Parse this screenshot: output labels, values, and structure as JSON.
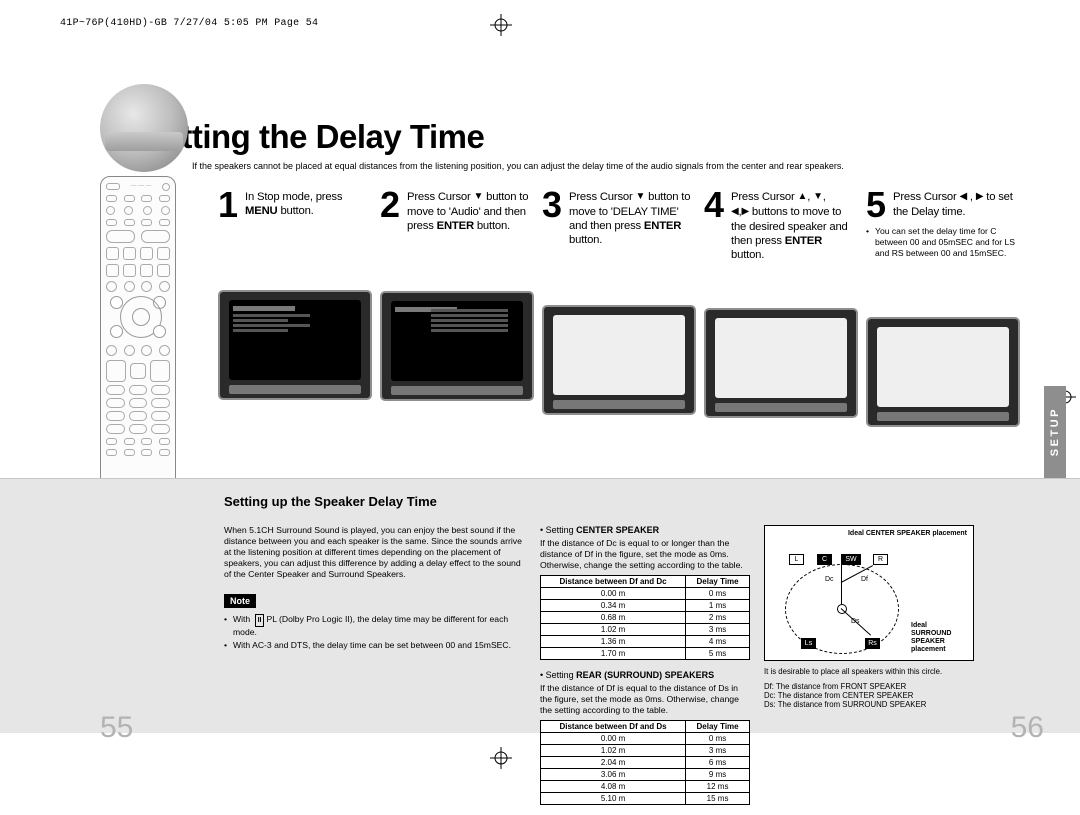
{
  "proofline": "41P~76P(410HD)-GB  7/27/04 5:05 PM  Page 54",
  "title": "Setting the Delay Time",
  "intro": "If the speakers cannot be placed at equal distances from the listening position, you can adjust the delay time of the audio signals from the center and rear speakers.",
  "tab": "SETUP",
  "steps": {
    "s1": {
      "num": "1",
      "pre": "In Stop mode, press ",
      "bold": "MENU",
      "post": " button."
    },
    "s2": {
      "num": "2",
      "pre": "Press Cursor ",
      "sym": "▼",
      "mid": " button to move to 'Audio' and then press ",
      "bold": "ENTER",
      "post": " button."
    },
    "s3": {
      "num": "3",
      "pre": "Press Cursor ",
      "sym": "▼",
      "mid": " button to move to 'DELAY TIME' and then press ",
      "bold": "ENTER",
      "post": " button."
    },
    "s4": {
      "num": "4",
      "l1a": "Press Cursor ",
      "l1b": "▲",
      "l1c": ", ",
      "l1d": "▼",
      "l1e": ",",
      "l2a": "◀",
      "l2b": ",",
      "l2c": "▶",
      "l2d": " buttons to move to the desired speaker and then press ",
      "bold": "ENTER",
      "post": " button."
    },
    "s5": {
      "num": "5",
      "pre": "Press Cursor ",
      "s1": "◀",
      "c": " , ",
      "s2": "▶",
      "post": " to set the Delay time."
    }
  },
  "note5": "You can set the delay time for C between 00 and 05mSEC and for LS and RS between 00 and 15mSEC.",
  "lower": {
    "heading": "Setting up the Speaker Delay Time",
    "para": "When 5.1CH Surround Sound is played, you can enjoy the best sound if the distance between you and each speaker is the same. Since the sounds arrive at the listening position at different times depending on the placement of speakers, you can adjust this difference by adding a delay effect to the sound of the Center Speaker and Surround Speakers.",
    "noteLabel": "Note",
    "note1": "With       PL  (Dolby Pro Logic II), the delay time may be different for each mode.",
    "pl2": "II",
    "note2": "With AC-3 and DTS, the delay time can be set between 00 and 15mSEC.",
    "center": {
      "h1": "• Setting ",
      "h2": "CENTER SPEAKER",
      "body": "If the distance of Dc is equal to or longer than the distance of Df in the figure, set the mode as 0ms. Otherwise, change the setting according to the table."
    },
    "rear": {
      "h1": "• Setting ",
      "h2": "REAR (SURROUND) SPEAKERS",
      "body": "If the distance of Df is equal to the distance of Ds in the figure, set the mode as 0ms. Otherwise, change the setting according to the table."
    },
    "t1": {
      "hd1": "Distance between Df and Dc",
      "hd2": "Delay Time",
      "r": [
        [
          "0.00 m",
          "0 ms"
        ],
        [
          "0.34 m",
          "1 ms"
        ],
        [
          "0.68 m",
          "2 ms"
        ],
        [
          "1.02 m",
          "3 ms"
        ],
        [
          "1.36 m",
          "4 ms"
        ],
        [
          "1.70 m",
          "5 ms"
        ]
      ]
    },
    "t2": {
      "hd1": "Distance between Df and Ds",
      "hd2": "Delay Time",
      "r": [
        [
          "0.00 m",
          "0 ms"
        ],
        [
          "1.02 m",
          "3 ms"
        ],
        [
          "2.04 m",
          "6 ms"
        ],
        [
          "3.06 m",
          "9 ms"
        ],
        [
          "4.08 m",
          "12 ms"
        ],
        [
          "5.10 m",
          "15 ms"
        ]
      ]
    },
    "diag": {
      "ideal_c": "Ideal CENTER SPEAKER placement",
      "ideal_s": "Ideal SURROUND SPEAKER placement",
      "circ": "It is desirable to place all speakers within this circle.",
      "df": "Df: The distance from FRONT SPEAKER",
      "dc": "Dc: The distance from CENTER SPEAKER",
      "ds": "Ds: The distance from SURROUND SPEAKER",
      "L": "L",
      "C": "C",
      "SW": "SW",
      "R": "R",
      "Dc": "Dc",
      "Df": "Df",
      "Ds": "Ds",
      "Ls": "Ls",
      "Rs": "Rs"
    }
  },
  "pages": {
    "left": "55",
    "right": "56"
  }
}
